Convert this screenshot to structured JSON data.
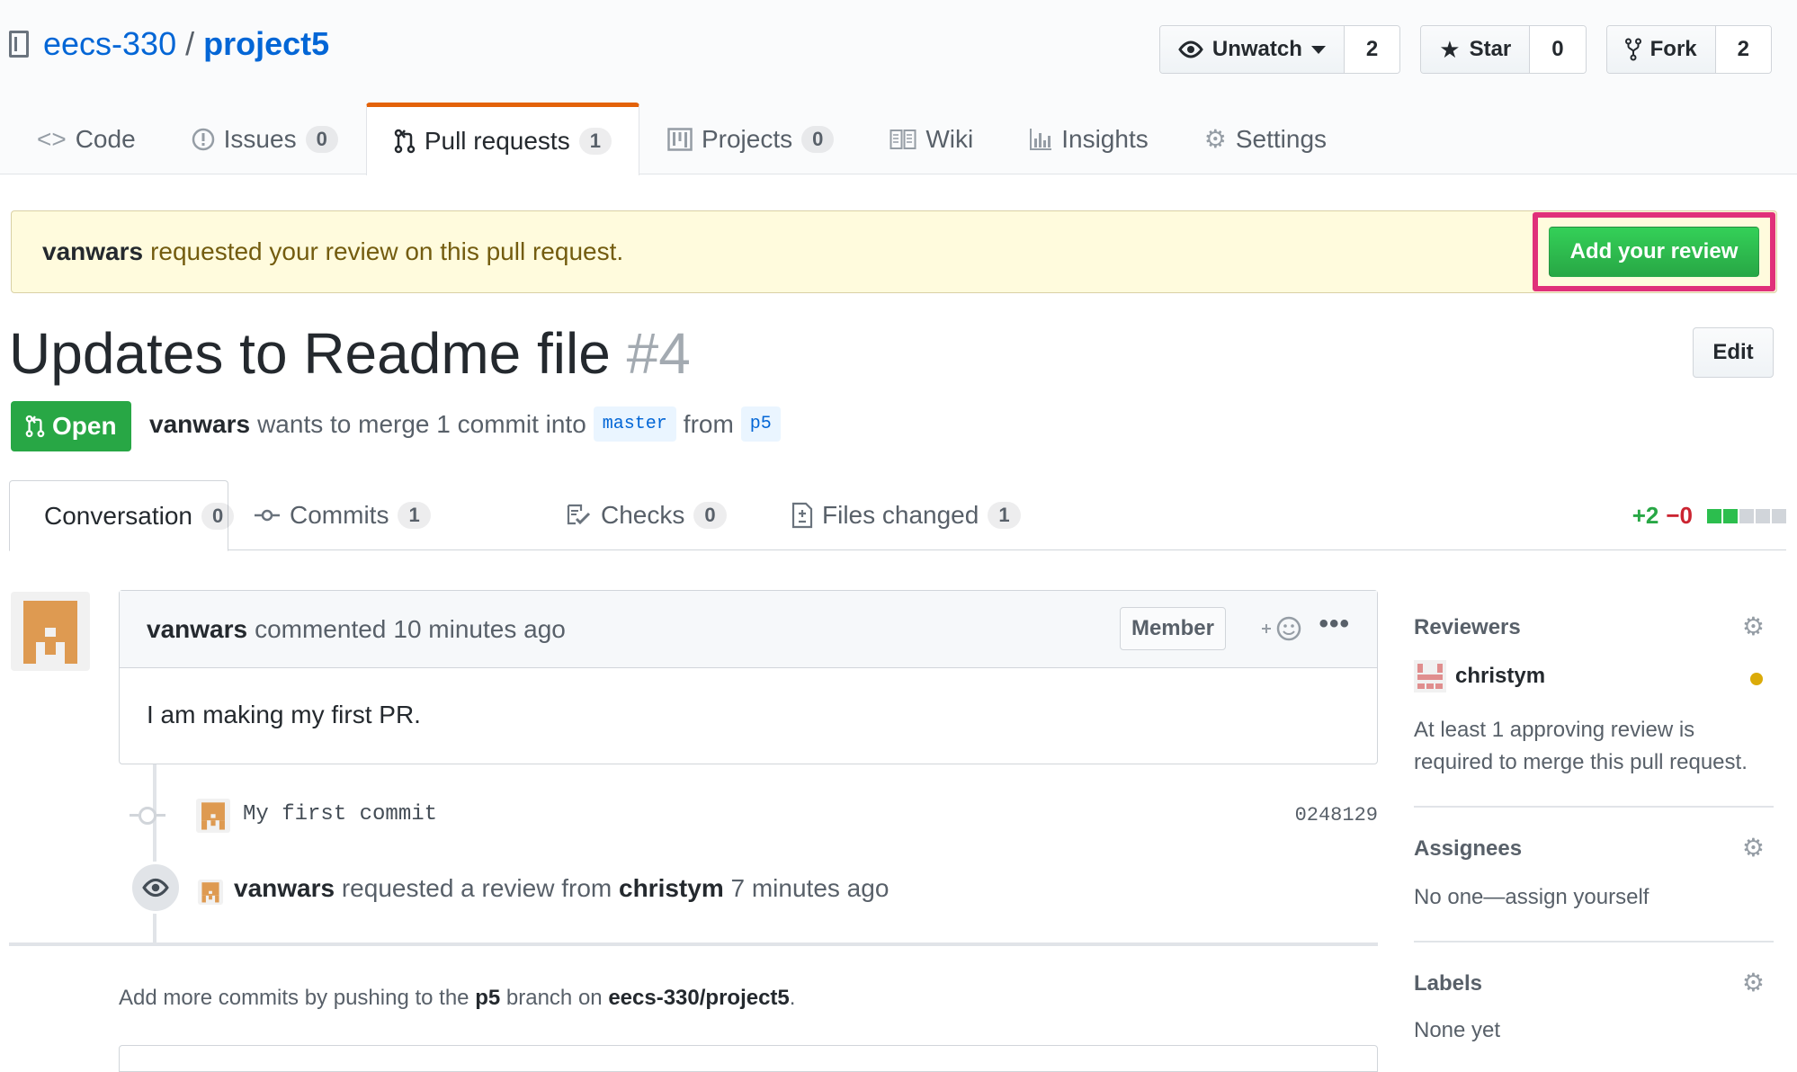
{
  "repo": {
    "owner": "eecs-330",
    "separator": "/",
    "name": "project5"
  },
  "actions": {
    "watch": {
      "label": "Unwatch",
      "count": "2"
    },
    "star": {
      "label": "Star",
      "count": "0"
    },
    "fork": {
      "label": "Fork",
      "count": "2"
    }
  },
  "nav": {
    "code": "Code",
    "issues": {
      "label": "Issues",
      "count": "0"
    },
    "pulls": {
      "label": "Pull requests",
      "count": "1"
    },
    "projects": {
      "label": "Projects",
      "count": "0"
    },
    "wiki": "Wiki",
    "insights": "Insights",
    "settings": "Settings"
  },
  "banner": {
    "user": "vanwars",
    "text": "requested your review on this pull request.",
    "button": "Add your review"
  },
  "pr": {
    "title": "Updates to Readme file",
    "number": "#4",
    "edit": "Edit",
    "state": "Open",
    "author": "vanwars",
    "merge_text": "wants to merge 1 commit into",
    "base_branch": "master",
    "from_text": "from",
    "head_branch": "p5"
  },
  "tabs": {
    "conversation": {
      "label": "Conversation",
      "count": "0"
    },
    "commits": {
      "label": "Commits",
      "count": "1"
    },
    "checks": {
      "label": "Checks",
      "count": "0"
    },
    "files": {
      "label": "Files changed",
      "count": "1"
    }
  },
  "diffstat": {
    "additions": "+2",
    "deletions": "−0"
  },
  "comment": {
    "author": "vanwars",
    "action": "commented",
    "time": "10 minutes ago",
    "role": "Member",
    "body": "I am making my first PR."
  },
  "commit": {
    "message": "My first commit",
    "sha": "0248129"
  },
  "event": {
    "actor": "vanwars",
    "text": "requested a review from",
    "target": "christym",
    "time": "7 minutes ago"
  },
  "merge_note": {
    "prefix": "Add more commits by pushing to the",
    "branch": "p5",
    "middle": "branch on",
    "repo": "eecs-330/project5",
    "suffix": "."
  },
  "sidebar": {
    "reviewers": {
      "heading": "Reviewers",
      "name": "christym",
      "note_line1": "At least 1 approving review is",
      "note_line2": "required to merge this pull request."
    },
    "assignees": {
      "heading": "Assignees",
      "note": "No one—assign yourself"
    },
    "labels": {
      "heading": "Labels",
      "note": "None yet"
    }
  },
  "colors": {
    "link": "#0366d6",
    "open_green": "#28a745",
    "banner_bg": "#fffbdd",
    "highlight": "#e0307a",
    "tab_accent": "#e36209",
    "pending": "#dbab09"
  },
  "icons": {
    "repo": "repo-book-icon",
    "watch": "eye-icon",
    "star": "star-icon",
    "fork": "fork-icon",
    "code": "code-icon",
    "issues": "issue-opened-icon",
    "pulls": "git-pull-request-icon",
    "projects": "project-icon",
    "wiki": "book-icon",
    "insights": "graph-icon",
    "settings": "gear-icon",
    "conversation": "comment-discussion-icon",
    "commits": "git-commit-icon",
    "checks": "checklist-icon",
    "files": "file-diff-icon",
    "reaction": "smiley-icon",
    "more": "kebab-horizontal-icon"
  }
}
